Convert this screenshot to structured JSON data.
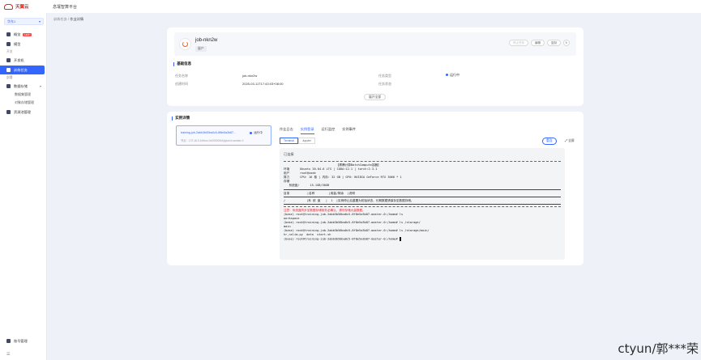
{
  "topbar": {
    "brand": "天翼云",
    "title": "息壤智算平台"
  },
  "sidebar": {
    "region": "华东1",
    "region_caret": "▾",
    "items": [
      {
        "label": "概览",
        "badge": "HOT"
      },
      {
        "label": "模型"
      },
      {
        "group": "开发"
      },
      {
        "label": "开发机"
      },
      {
        "label": "训练任务"
      },
      {
        "group": "部署"
      },
      {
        "label": "数据存储",
        "caret": "▾"
      },
      {
        "sub": "数据集管理"
      },
      {
        "sub": "对象存储管理"
      },
      {
        "label": "资源池管理"
      }
    ],
    "bottom_item": "账号管理",
    "footer_icon": "☰"
  },
  "breadcrumb": {
    "parent": "训练任务",
    "sep": "/",
    "current": "作业详情"
  },
  "job": {
    "name": "job-nkn2w",
    "tag": "量产",
    "buttons": [
      "停止任务",
      "编辑",
      "复制"
    ]
  },
  "basic_info": {
    "title": "基础信息",
    "rows": [
      {
        "label": "任务名称",
        "value": "job-nkn2w"
      },
      {
        "label": "创建时间",
        "value": "2025-03-11T17:43:03+08:00"
      },
      {
        "label": "任务类型",
        "value": "运行中",
        "status": "运行中"
      },
      {
        "label": "任务状态",
        "value": ""
      }
    ],
    "expand_label": "展开全部"
  },
  "instance": {
    "title": "实例详情",
    "name": "training-job-2abb3b50ba0c5-8f8e5a3b87...",
    "status": "运行中",
    "node": "节点：172.16.0.1/bbox-0x000000t4/pytorch-worker-0"
  },
  "tabs": [
    "作业日志",
    "实例登录",
    "运行监控",
    "实例事件"
  ],
  "subtabs": [
    "Terminal",
    "Jupyter"
  ],
  "connect_label": "重连",
  "fullscreen_label": "⤢ 全屏",
  "terminal": {
    "status": "已连接",
    "lines": [
      {
        "kind": "dash"
      },
      {
        "text": "                              【昇腾计算BatchCompute容器】",
        "kind": ""
      },
      {
        "text": "环境      Ubuntu 20.04.6 LTS | CUDA:12.1 | torch:2.3.1",
        "kind": ""
      },
      {
        "text": "用户      root@node",
        "kind": ""
      },
      {
        "text": "算力      CPU: 16 核 | 内存: 32 GB | GPU: NVIDIA GeForce RTX 3060 * 1",
        "kind": ""
      },
      {
        "text": "存储",
        "kind": ""
      },
      {
        "text": "   系统盘/      15.1GB/50GB",
        "kind": ""
      },
      {
        "kind": "rule"
      },
      {
        "text": "目录          |名称        |用量/剩余  |说明",
        "kind": ""
      },
      {
        "kind": "rule"
      },
      {
        "text": "/            |系 统 盘   |  1  |实例停止后重置为初始状态，长期数据请保存至数据存储。",
        "kind": ""
      },
      {
        "kind": "rule"
      },
      {
        "kind": "dash"
      },
      {
        "text": "注意：系统盘同步至数据存储前务必确认，请勿存储大量数据。",
        "kind": "warn"
      },
      {
        "text": "(base) root@training-job-2abb3b50ba0c5-8f8e5a3b87-master-0:/home# ls",
        "kind": ""
      },
      {
        "text": "workspace",
        "kind": ""
      },
      {
        "text": "(base) root@training-job-2abb3b50ba0c5-8f8e5a3b87-master-0:/home# ls /storage/",
        "kind": ""
      },
      {
        "text": "main",
        "kind": ""
      },
      {
        "text": "(base) root@training-job-2abb3b50ba0c5-8f8e5a3b87-master-0:/home# ls /storage/main/",
        "kind": ""
      },
      {
        "text": "hr_nslim.py  data  start.sh",
        "kind": ""
      },
      {
        "text": "(base) root@training-job-2abb3b50ba0c5-8f8e5a3b87-master-0:/home# ",
        "kind": "cursor"
      }
    ]
  },
  "watermark": "ctyun/郭***荣",
  "colors": {
    "accent": "#3366ff",
    "brand": "#e2231a",
    "warn": "#e0242f"
  }
}
